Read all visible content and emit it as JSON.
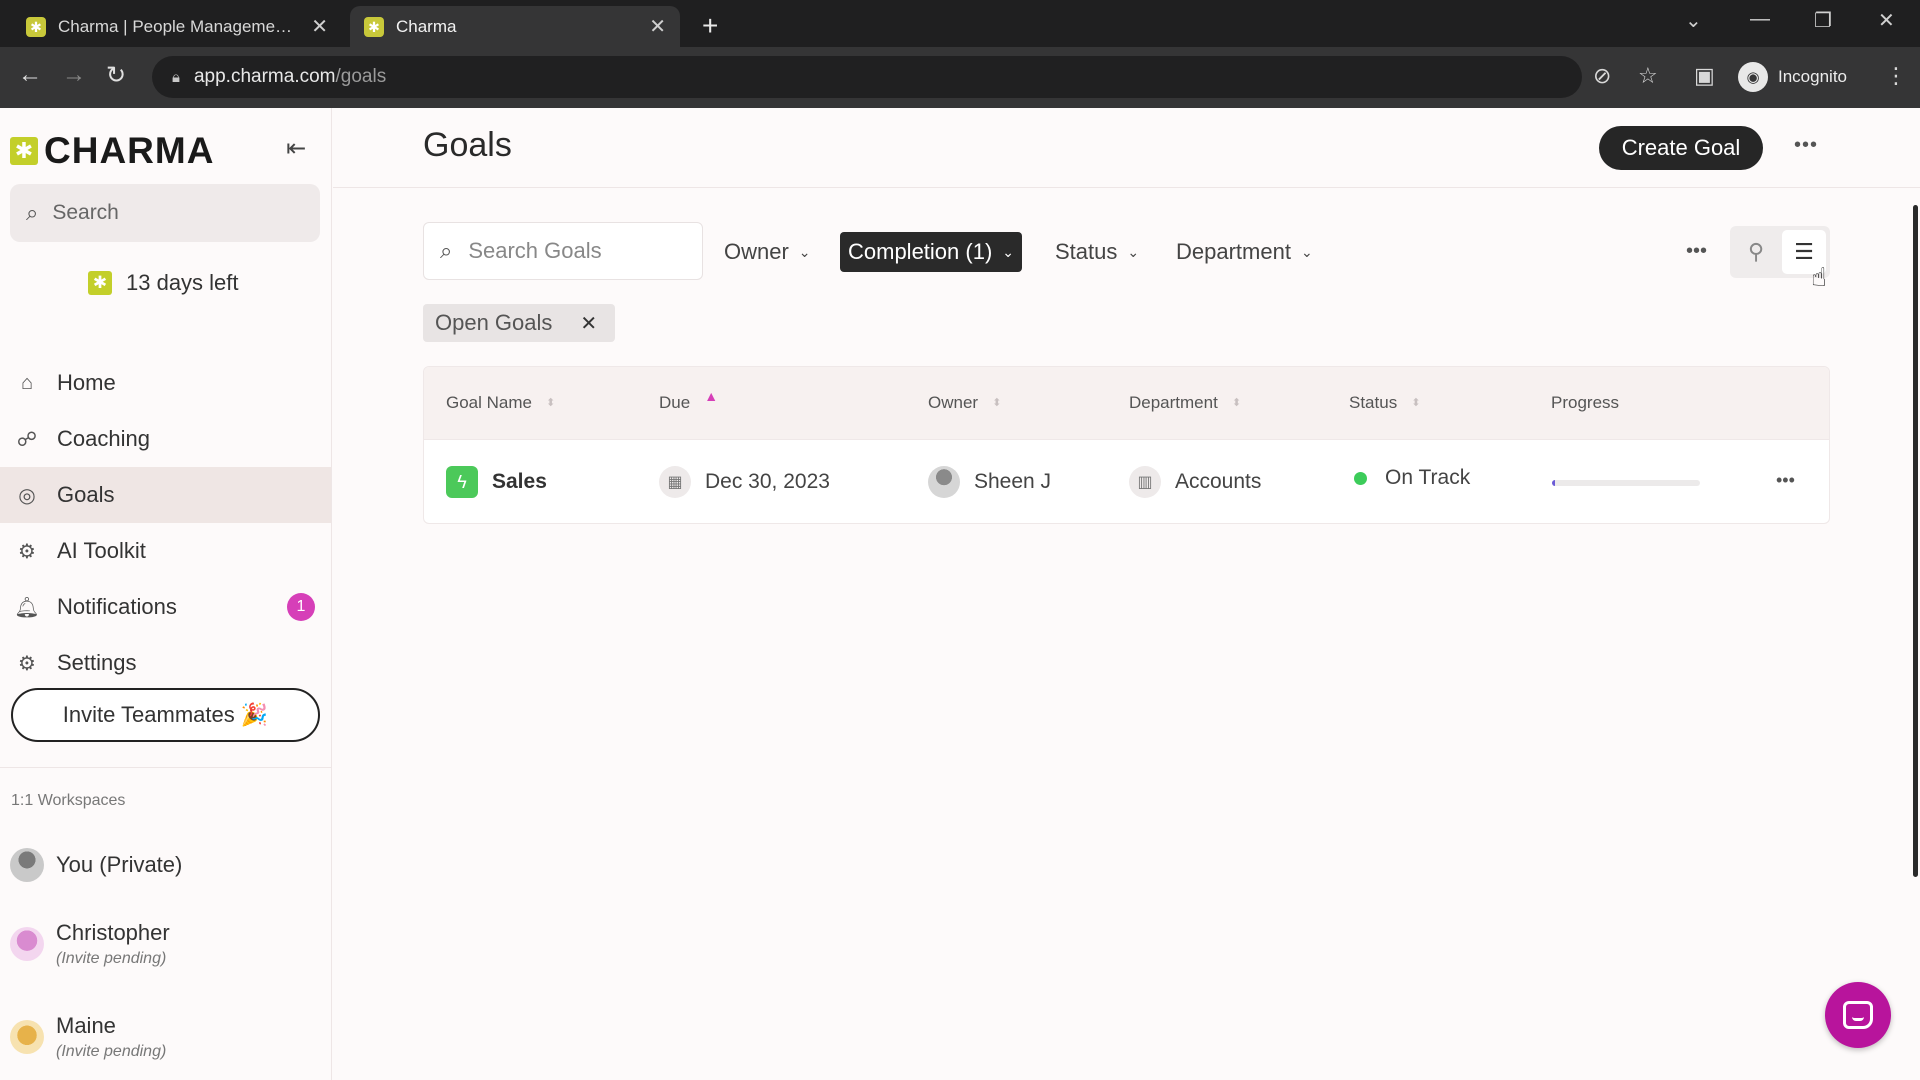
{
  "browser": {
    "tabs": [
      {
        "title": "Charma | People Management S",
        "active": false
      },
      {
        "title": "Charma",
        "active": true
      }
    ],
    "url_host": "app.charma.com",
    "url_path": "/goals",
    "profile_label": "Incognito"
  },
  "sidebar": {
    "brand": "CHARMA",
    "search_placeholder": "Search",
    "trial_text": "13 days left",
    "nav": [
      {
        "label": "Home",
        "icon": "home-icon",
        "active": false
      },
      {
        "label": "Coaching",
        "icon": "coaching-icon",
        "active": false
      },
      {
        "label": "Goals",
        "icon": "target-icon",
        "active": true
      },
      {
        "label": "AI Toolkit",
        "icon": "robot-icon",
        "active": false
      },
      {
        "label": "Notifications",
        "icon": "bell-icon",
        "active": false,
        "badge": "1"
      },
      {
        "label": "Settings",
        "icon": "gear-icon",
        "active": false
      }
    ],
    "invite_label": "Invite Teammates 🎉",
    "workspaces_title": "1:1 Workspaces",
    "workspaces": [
      {
        "name": "You (Private)",
        "sub": ""
      },
      {
        "name": "Christopher",
        "sub": "(Invite pending)"
      },
      {
        "name": "Maine",
        "sub": "(Invite pending)"
      }
    ]
  },
  "header": {
    "title": "Goals",
    "create_label": "Create Goal"
  },
  "filters": {
    "search_placeholder": "Search Goals",
    "items": [
      {
        "label": "Owner",
        "selected": false
      },
      {
        "label": "Completion (1)",
        "selected": true
      },
      {
        "label": "Status",
        "selected": false
      },
      {
        "label": "Department",
        "selected": false
      }
    ],
    "chip": "Open Goals"
  },
  "table": {
    "columns": [
      "Goal Name",
      "Due",
      "Owner",
      "Department",
      "Status",
      "Progress"
    ],
    "sorted_column": "Due",
    "rows": [
      {
        "goal": "Sales",
        "due": "Dec 30, 2023",
        "owner": "Sheen J",
        "department": "Accounts",
        "status": "On Track",
        "progress_pct": 2
      }
    ]
  },
  "colors": {
    "accent": "#d63fb8",
    "brand_mark": "#c3cf2a",
    "status_on_track": "#3ccc5a",
    "progress_fill": "#6b5bd6",
    "chat_button": "#b8149c"
  }
}
